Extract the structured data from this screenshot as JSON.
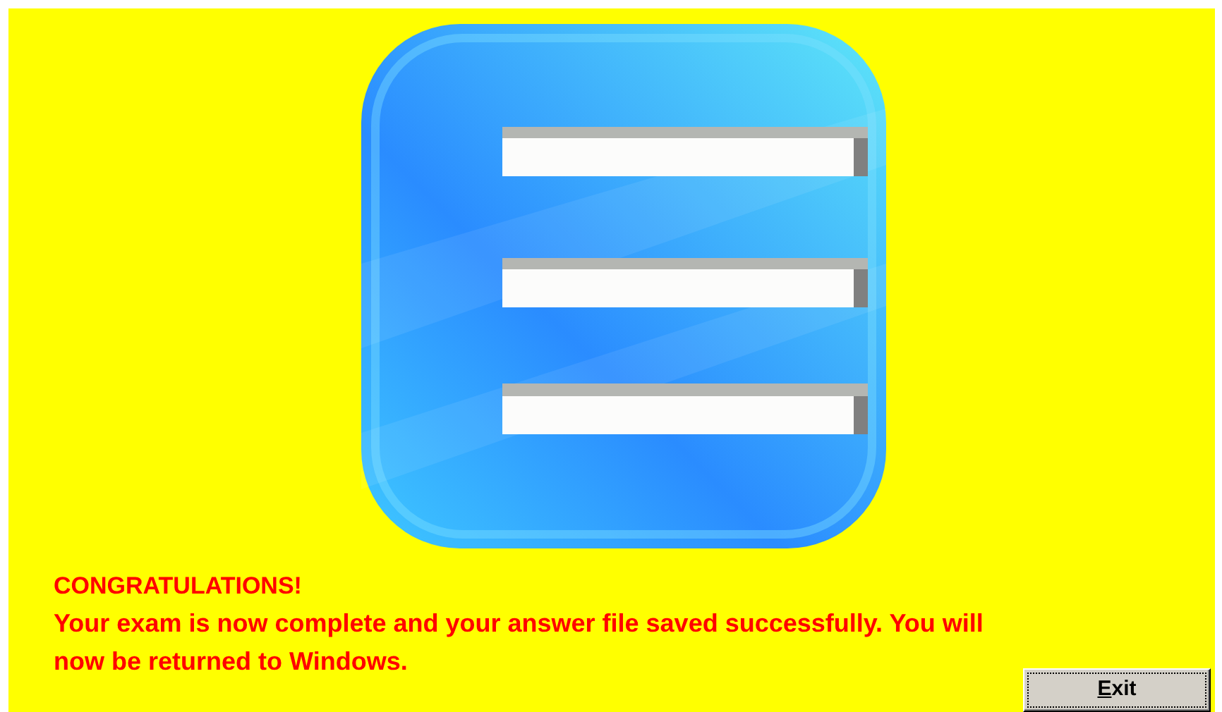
{
  "heading": "CONGRATULATIONS!",
  "message": "Your exam is now complete and your answer file saved successfully. You will now be returned to Windows.",
  "buttons": [
    {
      "label": "Exit"
    }
  ]
}
